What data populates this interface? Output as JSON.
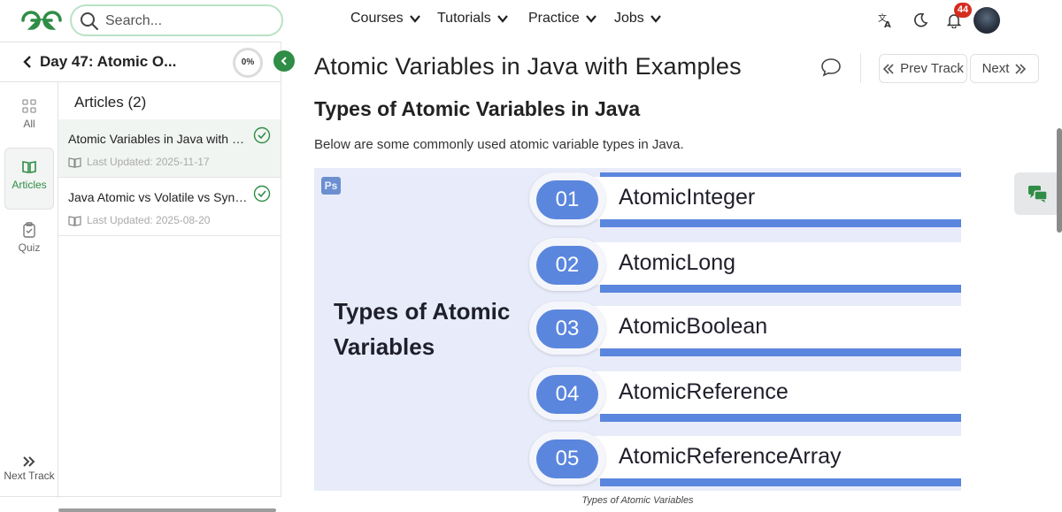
{
  "header": {
    "search_placeholder": "Search...",
    "nav": [
      "Courses",
      "Tutorials",
      "Practice",
      "Jobs"
    ],
    "notification_count": "44"
  },
  "sidebar": {
    "title": "Day 47: Atomic O...",
    "progress": "0%",
    "rail": [
      {
        "label": "All",
        "icon": "grid-icon"
      },
      {
        "label": "Articles",
        "icon": "book-icon",
        "active": true
      },
      {
        "label": "Quiz",
        "icon": "clipboard-icon"
      }
    ],
    "next_track": "Next Track",
    "articles_heading": "Articles (2)",
    "articles": [
      {
        "title": "Atomic Variables in Java with E...",
        "meta": "Last Updated: 2025-11-17",
        "selected": true
      },
      {
        "title": "Java Atomic vs Volatile vs Sync...",
        "meta": "Last Updated: 2025-08-20",
        "selected": false
      }
    ]
  },
  "main": {
    "title": "Atomic Variables in Java with Examples",
    "prev_track": "Prev Track",
    "next": "Next",
    "section_heading": "Types of Atomic Variables in Java",
    "paragraph": "Below are some commonly used atomic variable types in Java.",
    "figure": {
      "badge": "Ps",
      "title_line1": "Types of Atomic",
      "title_line2": "Variables",
      "items": [
        {
          "num": "01",
          "label": "AtomicInteger"
        },
        {
          "num": "02",
          "label": "AtomicLong"
        },
        {
          "num": "03",
          "label": "AtomicBoolean"
        },
        {
          "num": "04",
          "label": "AtomicReference"
        },
        {
          "num": "05",
          "label": "AtomicReferenceArray"
        }
      ],
      "caption": "Types of Atomic Variables"
    }
  },
  "colors": {
    "brand_green": "#2f8d46",
    "figure_blue": "#5b86dd",
    "badge_red": "#d62c1f"
  }
}
